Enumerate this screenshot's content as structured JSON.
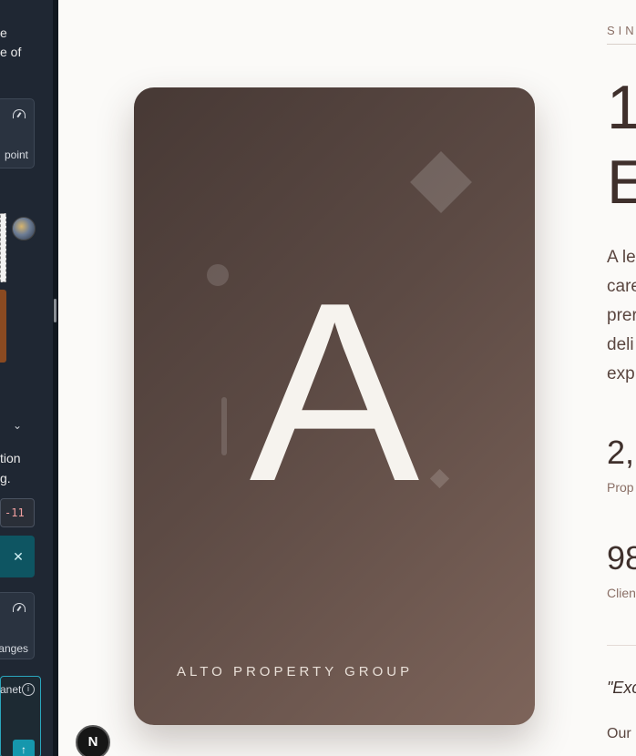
{
  "sidebar": {
    "text_top": [
      "e",
      "e of"
    ],
    "card1_label": "point",
    "text_mid": [
      "tion",
      "g."
    ],
    "badge_value": "-11",
    "close_glyph": "✕",
    "card2_label": "anges",
    "chat_label": "anet",
    "info_glyph": "i",
    "send_glyph": "↑",
    "chevron_glyph": "⌄",
    "icons": [
      "gauge-icon",
      "avatar",
      "chevron-down-icon",
      "close-icon",
      "info-icon",
      "arrow-up-icon"
    ]
  },
  "hero": {
    "letter": "A",
    "brand": "ALTO PROPERTY GROUP"
  },
  "badge": {
    "letter": "N"
  },
  "right": {
    "since": "SIN",
    "big_num": "1",
    "big_word": "E",
    "para_lines": [
      "A le",
      "care",
      "prer",
      "deli",
      "exp"
    ],
    "stat1_num": "2,",
    "stat1_label": "Prop",
    "stat2_num": "98",
    "stat2_label": "Clien",
    "quote": "\"Exc",
    "our": "Our"
  },
  "colors": {
    "sidebar_bg": "#1f2733",
    "hero_start": "#473935",
    "hero_end": "#7d645a",
    "accent_teal": "#0e5562",
    "page_bg": "#fbfaf8"
  }
}
